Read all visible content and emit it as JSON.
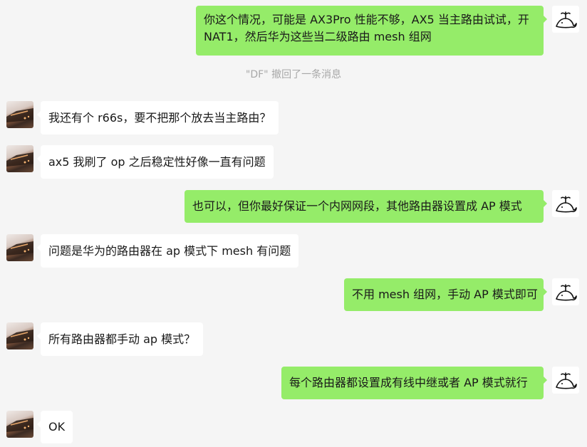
{
  "messages": [
    {
      "side": "out",
      "text": "你这个情况，可能是 AX3Pro 性能不够，AX5 当主路由试试，开 NAT1，然后华为这些当二级路由 mesh 组网"
    },
    {
      "side": "in",
      "text": "我还有个 r66s，要不把那个放去当主路由？"
    },
    {
      "side": "in",
      "text": "ax5 我刷了 op 之后稳定性好像一直有问题"
    },
    {
      "side": "out",
      "text": "也可以，但你最好保证一个内网网段，其他路由器设置成 AP 模式"
    },
    {
      "side": "in",
      "text": "问题是华为的路由器在 ap 模式下 mesh 有问题"
    },
    {
      "side": "out",
      "text": "不用 mesh 组网，手动 AP 模式即可"
    },
    {
      "side": "in",
      "text": "所有路由器都手动 ap 模式？"
    },
    {
      "side": "out",
      "text": "每个路由器都设置成有线中继或者 AP 模式就行"
    },
    {
      "side": "in",
      "text": "OK"
    }
  ],
  "system_notice": "\"DF\" 撤回了一条消息",
  "colors": {
    "background": "#f5f5f5",
    "bubble_out": "#95ec69",
    "bubble_in": "#ffffff",
    "notice_text": "#a8a8a8"
  },
  "icons": {
    "self_avatar": "whale-sprout-icon",
    "contact_avatar": "photo-avatar"
  }
}
